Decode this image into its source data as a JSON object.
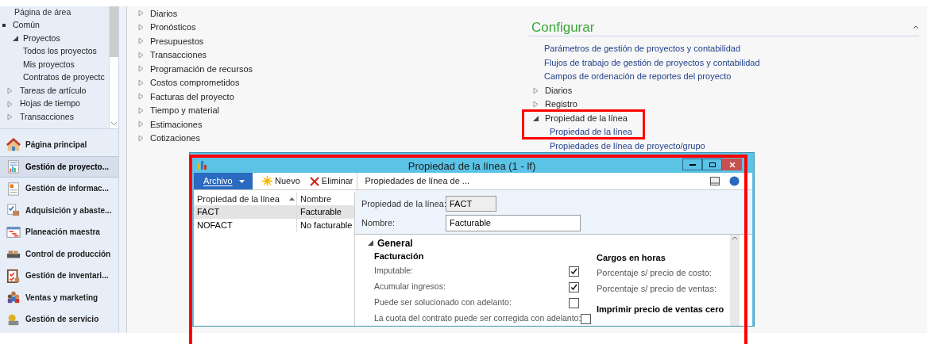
{
  "nav": {
    "tree": [
      {
        "label": "Página de área",
        "kind": "header"
      },
      {
        "label": "Común",
        "kind": "root",
        "expanded": true,
        "children": [
          {
            "label": "Proyectos",
            "kind": "node",
            "expanded": true,
            "children": [
              {
                "label": "Todos los proyectos",
                "kind": "leaf"
              },
              {
                "label": "Mis proyectos",
                "kind": "leaf"
              },
              {
                "label": "Contratos de proyectc",
                "kind": "leaf"
              }
            ]
          },
          {
            "label": "Tareas de artículo",
            "kind": "node",
            "expanded": false
          },
          {
            "label": "Hojas de tiempo",
            "kind": "node",
            "expanded": false
          },
          {
            "label": "Transacciones",
            "kind": "node",
            "expanded": false
          }
        ]
      }
    ],
    "modules": [
      {
        "label": "Página principal",
        "selected": false
      },
      {
        "label": "Gestión de proyecto...",
        "selected": true
      },
      {
        "label": "Gestión de informac...",
        "selected": false
      },
      {
        "label": "Adquisición y abaste...",
        "selected": false
      },
      {
        "label": "Planeación maestra",
        "selected": false
      },
      {
        "label": "Control de producción",
        "selected": false
      },
      {
        "label": "Gestión de inventari...",
        "selected": false
      },
      {
        "label": "Ventas y marketing",
        "selected": false
      },
      {
        "label": "Gestión de servicio",
        "selected": false
      }
    ]
  },
  "middle_list": [
    {
      "label": "Diarios",
      "expanded": false
    },
    {
      "label": "Pronósticos",
      "expanded": false
    },
    {
      "label": "Presupuestos",
      "expanded": false
    },
    {
      "label": "Transacciones",
      "expanded": false
    },
    {
      "label": "Programación de recursos",
      "expanded": false
    },
    {
      "label": "Costos comprometidos",
      "expanded": false
    },
    {
      "label": "Facturas del proyecto",
      "expanded": false
    },
    {
      "label": "Tiempo y material",
      "expanded": false
    },
    {
      "label": "Estimaciones",
      "expanded": false
    },
    {
      "label": "Cotizaciones",
      "expanded": false
    }
  ],
  "setup": {
    "title": "Configurar",
    "items": [
      {
        "label": "Parámetros de gestión de proyectos y contabilidad",
        "kind": "link"
      },
      {
        "label": "Flujos de trabajo de gestión de proyectos y contabilidad",
        "kind": "link"
      },
      {
        "label": "Campos de ordenación de reportes del proyecto",
        "kind": "link"
      },
      {
        "label": "Diarios",
        "kind": "node",
        "expanded": false
      },
      {
        "label": "Registro",
        "kind": "node",
        "expanded": false
      },
      {
        "label": "Propiedad de la línea",
        "kind": "node",
        "expanded": true,
        "children": [
          {
            "label": "Propiedad de la línea",
            "kind": "link"
          },
          {
            "label": "Propiedades de línea de proyecto/grupo",
            "kind": "link"
          }
        ]
      }
    ]
  },
  "dialog": {
    "title": "Propiedad de la línea (1 - lf)",
    "toolbar": [
      {
        "label": "Archivo",
        "kind": "menu"
      },
      {
        "label": "Nuevo",
        "kind": "new"
      },
      {
        "label": "Eliminar",
        "kind": "delete"
      },
      {
        "label": "Propiedades de línea de ...",
        "kind": "text"
      }
    ],
    "grid": {
      "columns": [
        "Propiedad de la línea",
        "Nombre"
      ],
      "rows": [
        {
          "cells": [
            "FACT",
            "Facturable"
          ],
          "selected": true
        },
        {
          "cells": [
            "NOFACT",
            "No facturable"
          ],
          "selected": false
        }
      ]
    },
    "fields": [
      {
        "label": "Propiedad de la línea:",
        "value": "FACT",
        "kind": "readonly"
      },
      {
        "label": "Nombre:",
        "value": "Facturable",
        "kind": "input"
      }
    ],
    "section": {
      "title": "General",
      "expanded": true
    },
    "left_group": {
      "title": "Facturación",
      "rows": [
        {
          "label": "Imputable:",
          "checked": true
        },
        {
          "label": "Acumular ingresos:",
          "checked": true
        },
        {
          "label": "Puede ser solucionado con adelanto:",
          "checked": false
        },
        {
          "label": "La cuota del contrato puede ser corregida con adelanto:",
          "checked": false
        }
      ]
    },
    "right_groups": [
      {
        "title": "Cargos en horas",
        "labels": [
          "Porcentaje s/ precio de costo:",
          "Porcentaje s/ precio de ventas:"
        ]
      },
      {
        "title": "Imprimir precio de ventas cero"
      }
    ]
  }
}
